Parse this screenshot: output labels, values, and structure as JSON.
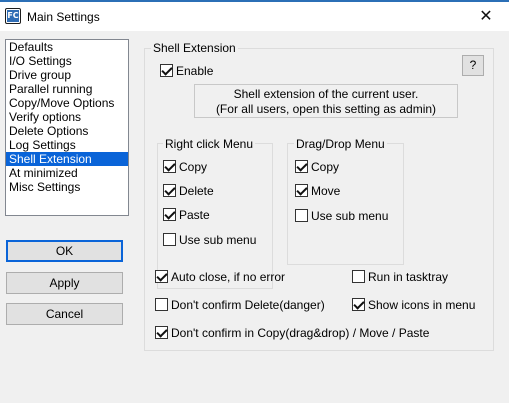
{
  "window": {
    "title": "Main Settings",
    "app_icon_text": "FC",
    "close_glyph": "✕"
  },
  "sidebar": {
    "items": [
      {
        "label": "Defaults",
        "selected": false
      },
      {
        "label": "I/O Settings",
        "selected": false
      },
      {
        "label": "Drive group",
        "selected": false
      },
      {
        "label": "Parallel running",
        "selected": false
      },
      {
        "label": "Copy/Move Options",
        "selected": false
      },
      {
        "label": "Verify options",
        "selected": false
      },
      {
        "label": "Delete Options",
        "selected": false
      },
      {
        "label": "Log Settings",
        "selected": false
      },
      {
        "label": "Shell Extension",
        "selected": true
      },
      {
        "label": "At minimized",
        "selected": false
      },
      {
        "label": "Misc Settings",
        "selected": false
      }
    ]
  },
  "buttons": {
    "ok": "OK",
    "apply": "Apply",
    "cancel": "Cancel",
    "help": "?"
  },
  "shell_extension": {
    "group_title": "Shell Extension",
    "enable": {
      "label": "Enable",
      "checked": true
    },
    "info_line1": "Shell extension of the current user.",
    "info_line2": "(For all users, open this setting as admin)",
    "right_click_menu": {
      "title": "Right click Menu",
      "items": [
        {
          "label": "Copy",
          "checked": true
        },
        {
          "label": "Delete",
          "checked": true
        },
        {
          "label": "Paste",
          "checked": true
        },
        {
          "label": "Use sub menu",
          "checked": false
        }
      ]
    },
    "drag_drop_menu": {
      "title": "Drag/Drop Menu",
      "items": [
        {
          "label": "Copy",
          "checked": true
        },
        {
          "label": "Move",
          "checked": true
        },
        {
          "label": "Use sub menu",
          "checked": false
        }
      ]
    },
    "options": {
      "auto_close": {
        "label": "Auto close, if no error",
        "checked": true
      },
      "run_in_tasktray": {
        "label": "Run in tasktray",
        "checked": false
      },
      "dont_confirm_delete": {
        "label": "Don't confirm Delete(danger)",
        "checked": false
      },
      "show_icons_in_menu": {
        "label": "Show icons in menu",
        "checked": true
      },
      "dont_confirm_copy": {
        "label": "Don't confirm in Copy(drag&drop) / Move / Paste",
        "checked": true
      }
    }
  },
  "colors": {
    "selection": "#0a64d8",
    "titlebar_accent": "#2b6fb6",
    "window_bg": "#f0f0f0"
  }
}
